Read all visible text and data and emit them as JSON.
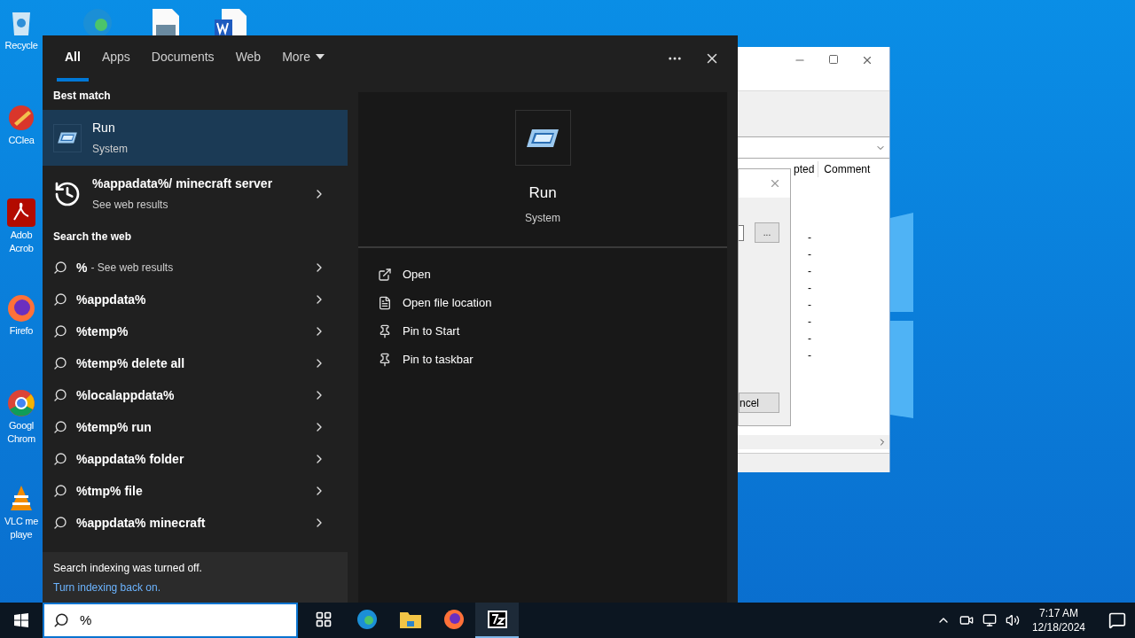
{
  "desktop": {
    "icons": [
      {
        "kind": "recycle",
        "label": [
          "Recycle"
        ]
      },
      {
        "kind": "ccleaner",
        "label": [
          "CClea"
        ]
      },
      {
        "kind": "acrobat",
        "label": [
          "Adob",
          "Acrob"
        ]
      },
      {
        "kind": "firefox",
        "label": [
          "Firefo"
        ]
      },
      {
        "kind": "chrome",
        "label": [
          "Googl",
          "Chrom"
        ]
      },
      {
        "kind": "vlc",
        "label": [
          "VLC me",
          "playe"
        ]
      }
    ]
  },
  "background_window": {
    "columns": [
      "pted",
      "Comment"
    ],
    "cells": [
      "-",
      "-",
      "-",
      "-",
      "-",
      "-",
      "-",
      "-"
    ],
    "dialog": {
      "browse_button": "...",
      "cancel_button": "ncel"
    }
  },
  "search_panel": {
    "tabs": [
      {
        "label": "All",
        "selected": true
      },
      {
        "label": "Apps",
        "selected": false
      },
      {
        "label": "Documents",
        "selected": false
      },
      {
        "label": "Web",
        "selected": false
      },
      {
        "label": "More",
        "selected": false
      }
    ],
    "best_match_heading": "Best match",
    "best_match": {
      "title": "Run",
      "subtitle": "System",
      "selected": true
    },
    "history": {
      "title": "%appadata%/ minecraft server",
      "subtitle": "See web results"
    },
    "web_heading": "Search the web",
    "suggestions": [
      {
        "text": "%",
        "suffix": "- See web results"
      },
      {
        "text": "%appdata%"
      },
      {
        "text": "%temp%"
      },
      {
        "text": "%temp% delete all"
      },
      {
        "text": "%localappdata%"
      },
      {
        "text": "%temp% run"
      },
      {
        "text": "%appdata% folder"
      },
      {
        "text": "%tmp% file"
      },
      {
        "text": "%appdata% minecraft"
      }
    ],
    "footer": {
      "message": "Search indexing was turned off.",
      "link": "Turn indexing back on."
    },
    "detail": {
      "title": "Run",
      "subtitle": "System",
      "actions": [
        {
          "kind": "open",
          "label": "Open"
        },
        {
          "kind": "location",
          "label": "Open file location"
        },
        {
          "kind": "pin",
          "label": "Pin to Start"
        },
        {
          "kind": "pin",
          "label": "Pin to taskbar"
        }
      ]
    }
  },
  "taskbar": {
    "search_value": "%",
    "apps": [
      {
        "kind": "taskview",
        "active": false
      },
      {
        "kind": "edge",
        "active": false
      },
      {
        "kind": "folder",
        "active": false
      },
      {
        "kind": "firefox",
        "active": false
      },
      {
        "kind": "sevenzip",
        "active": true
      }
    ],
    "time": "7:17 AM",
    "date": "12/18/2024"
  }
}
